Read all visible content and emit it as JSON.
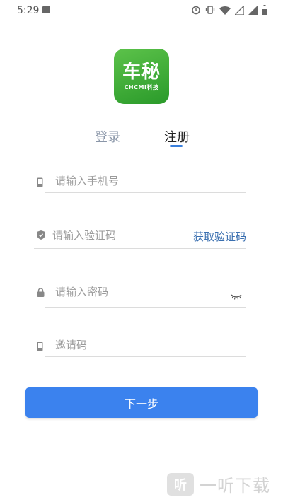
{
  "status_bar": {
    "time": "5:29"
  },
  "logo": {
    "main_text": "车秘",
    "sub_text": "CHCMI科技"
  },
  "tabs": {
    "login": "登录",
    "register": "注册"
  },
  "form": {
    "phone_placeholder": "请输入手机号",
    "code_placeholder": "请输入验证码",
    "get_code_label": "获取验证码",
    "password_placeholder": "请输入密码",
    "invite_placeholder": "邀请码"
  },
  "actions": {
    "next_label": "下一步"
  },
  "watermark": {
    "badge": "听",
    "text": "一听下载"
  },
  "colors": {
    "accent": "#3b82ee",
    "logo_green": "#3aa83a",
    "link": "#3a6fb0"
  }
}
